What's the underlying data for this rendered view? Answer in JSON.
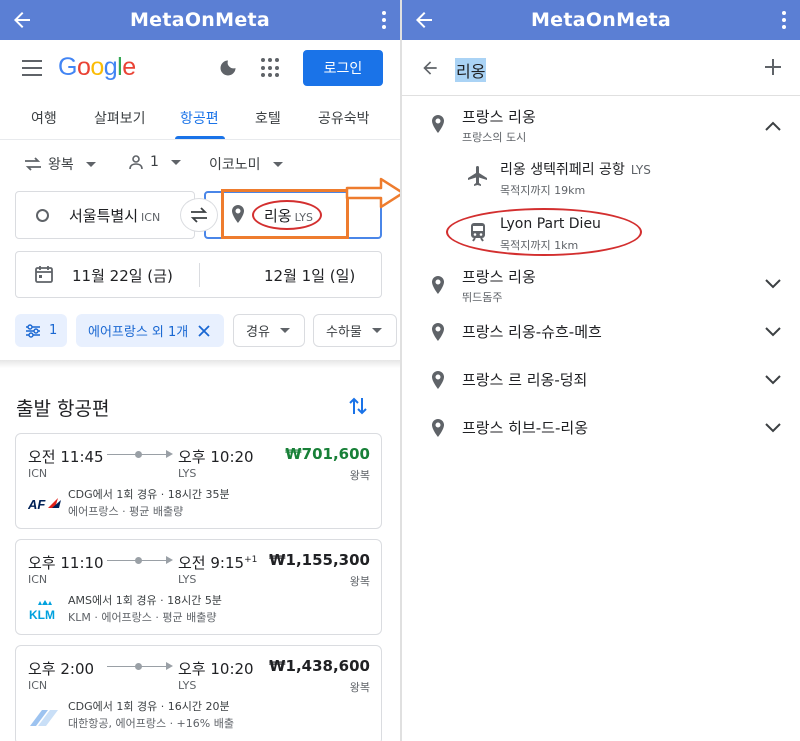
{
  "colors": {
    "appbar": "#5b7fd4",
    "accent": "#1a73e8",
    "price_green": "#188038",
    "highlight_orange": "#ee7c2e",
    "highlight_red": "#d32f2f",
    "query_highlight": "#aad3f5"
  },
  "left": {
    "appbar": {
      "title": "MetaOnMeta"
    },
    "header": {
      "logo": [
        "G",
        "o",
        "o",
        "g",
        "l",
        "e"
      ],
      "login_label": "로그인"
    },
    "tabs": [
      "여행",
      "살펴보기",
      "항공편",
      "호텔",
      "공유숙박"
    ],
    "active_tab": "항공편",
    "options": {
      "trip_type": "왕복",
      "passengers": "1",
      "cabin": "이코노미"
    },
    "search": {
      "from_value": "서울특별시",
      "from_code": "ICN",
      "to_value": "리옹",
      "to_code": "LYS",
      "depart_date": "11월 22일 (금)",
      "return_date": "12월 1일 (일)"
    },
    "filters": {
      "filter_count": "1",
      "airline_chip": "에어프랑스 외 1개",
      "stops": "경유",
      "bags": "수하물"
    },
    "section_title": "출발 항공편",
    "flights": [
      {
        "depart": "오전 11:45",
        "arrive": "오후 10:20",
        "arrive_sup": "",
        "from": "ICN",
        "to": "LYS",
        "price": "₩701,600",
        "trip": "왕복",
        "detail": "CDG에서 1회 경유 · 18시간 35분",
        "sub": "에어프랑스 · 평균 배출량",
        "logo": "air-france-logo",
        "logo_text": "AF"
      },
      {
        "depart": "오후 11:10",
        "arrive": "오전 9:15",
        "arrive_sup": "+1",
        "from": "ICN",
        "to": "LYS",
        "price": "₩1,155,300",
        "trip": "왕복",
        "detail": "AMS에서 1회 경유 · 18시간 5분",
        "sub": "KLM · 에어프랑스 · 평균 배출량",
        "logo": "klm-logo",
        "logo_text": "KLM"
      },
      {
        "depart": "오후 2:00",
        "arrive": "오후 10:20",
        "arrive_sup": "",
        "from": "ICN",
        "to": "LYS",
        "price": "₩1,438,600",
        "trip": "왕복",
        "detail": "CDG에서 1회 경유 · 16시간 20분",
        "sub": "대한항공, 에어프랑스 · +16% 배출",
        "logo": "multi-airline-logo",
        "logo_text": ""
      }
    ]
  },
  "right": {
    "appbar": {
      "title": "MetaOnMeta"
    },
    "query": "리옹",
    "results": [
      {
        "main": "프랑스 리옹",
        "sub": "프랑스의 도시",
        "expanded": true,
        "children": [
          {
            "icon": "airplane-icon",
            "main": "리옹 생텍쥐페리 공항",
            "code": "LYS",
            "sub": "목적지까지 19km"
          },
          {
            "icon": "train-icon",
            "main": "Lyon Part Dieu",
            "code": "",
            "sub": "목적지까지 1km"
          }
        ]
      },
      {
        "main": "프랑스 리옹",
        "sub": "뛰드돔주",
        "expanded": false
      },
      {
        "main": "프랑스 리옹-슈흐-메흐",
        "sub": "",
        "expanded": false
      },
      {
        "main": "프랑스 르 리옹-덩죄",
        "sub": "",
        "expanded": false
      },
      {
        "main": "프랑스 히브-드-리옹",
        "sub": "",
        "expanded": false
      }
    ]
  }
}
